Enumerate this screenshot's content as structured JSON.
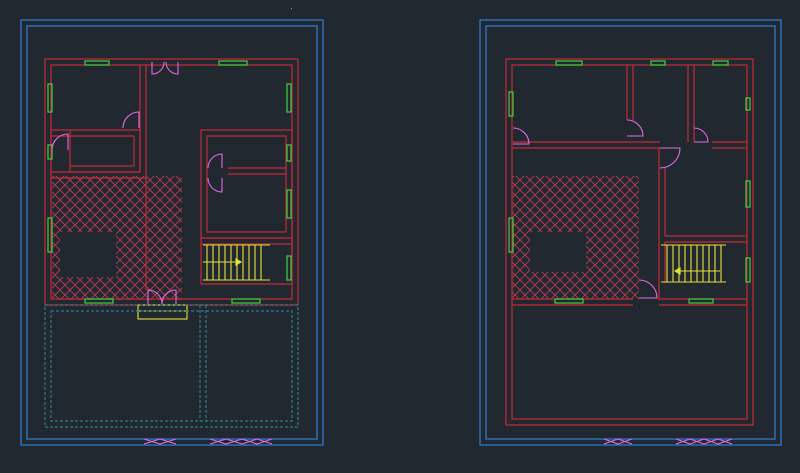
{
  "canvas": {
    "background": "#212830"
  },
  "colors": {
    "border": "#2f7fd6",
    "wall": "#c42a36",
    "window": "#3ed23e",
    "door": "#e06be0",
    "hatch": "#c43a55",
    "stair": "#e6e13a",
    "dashed": "#2f8f9a"
  },
  "drawings": [
    {
      "id": "ground-floor-plan",
      "has_hatched_court": true,
      "has_staircase": true,
      "has_dashed_parking": true
    },
    {
      "id": "first-floor-plan",
      "has_hatched_court": true,
      "has_staircase": true,
      "has_dashed_parking": false
    }
  ]
}
